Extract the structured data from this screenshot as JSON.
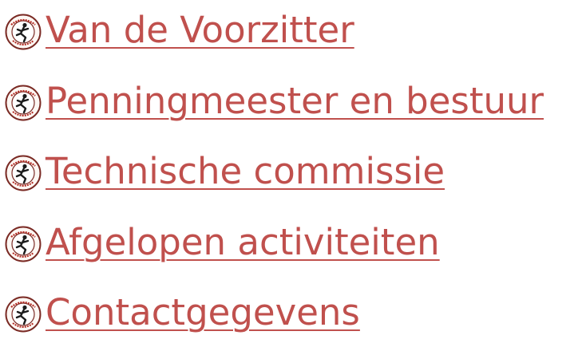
{
  "menu": {
    "accent_color": "#c0504d",
    "icon": "club-logo-runner-icon",
    "items": [
      {
        "label": "Van de Voorzitter"
      },
      {
        "label": "Penningmeester en bestuur"
      },
      {
        "label": "Technische commissie"
      },
      {
        "label": "Afgelopen activiteiten"
      },
      {
        "label": "Contactgegevens"
      }
    ]
  }
}
